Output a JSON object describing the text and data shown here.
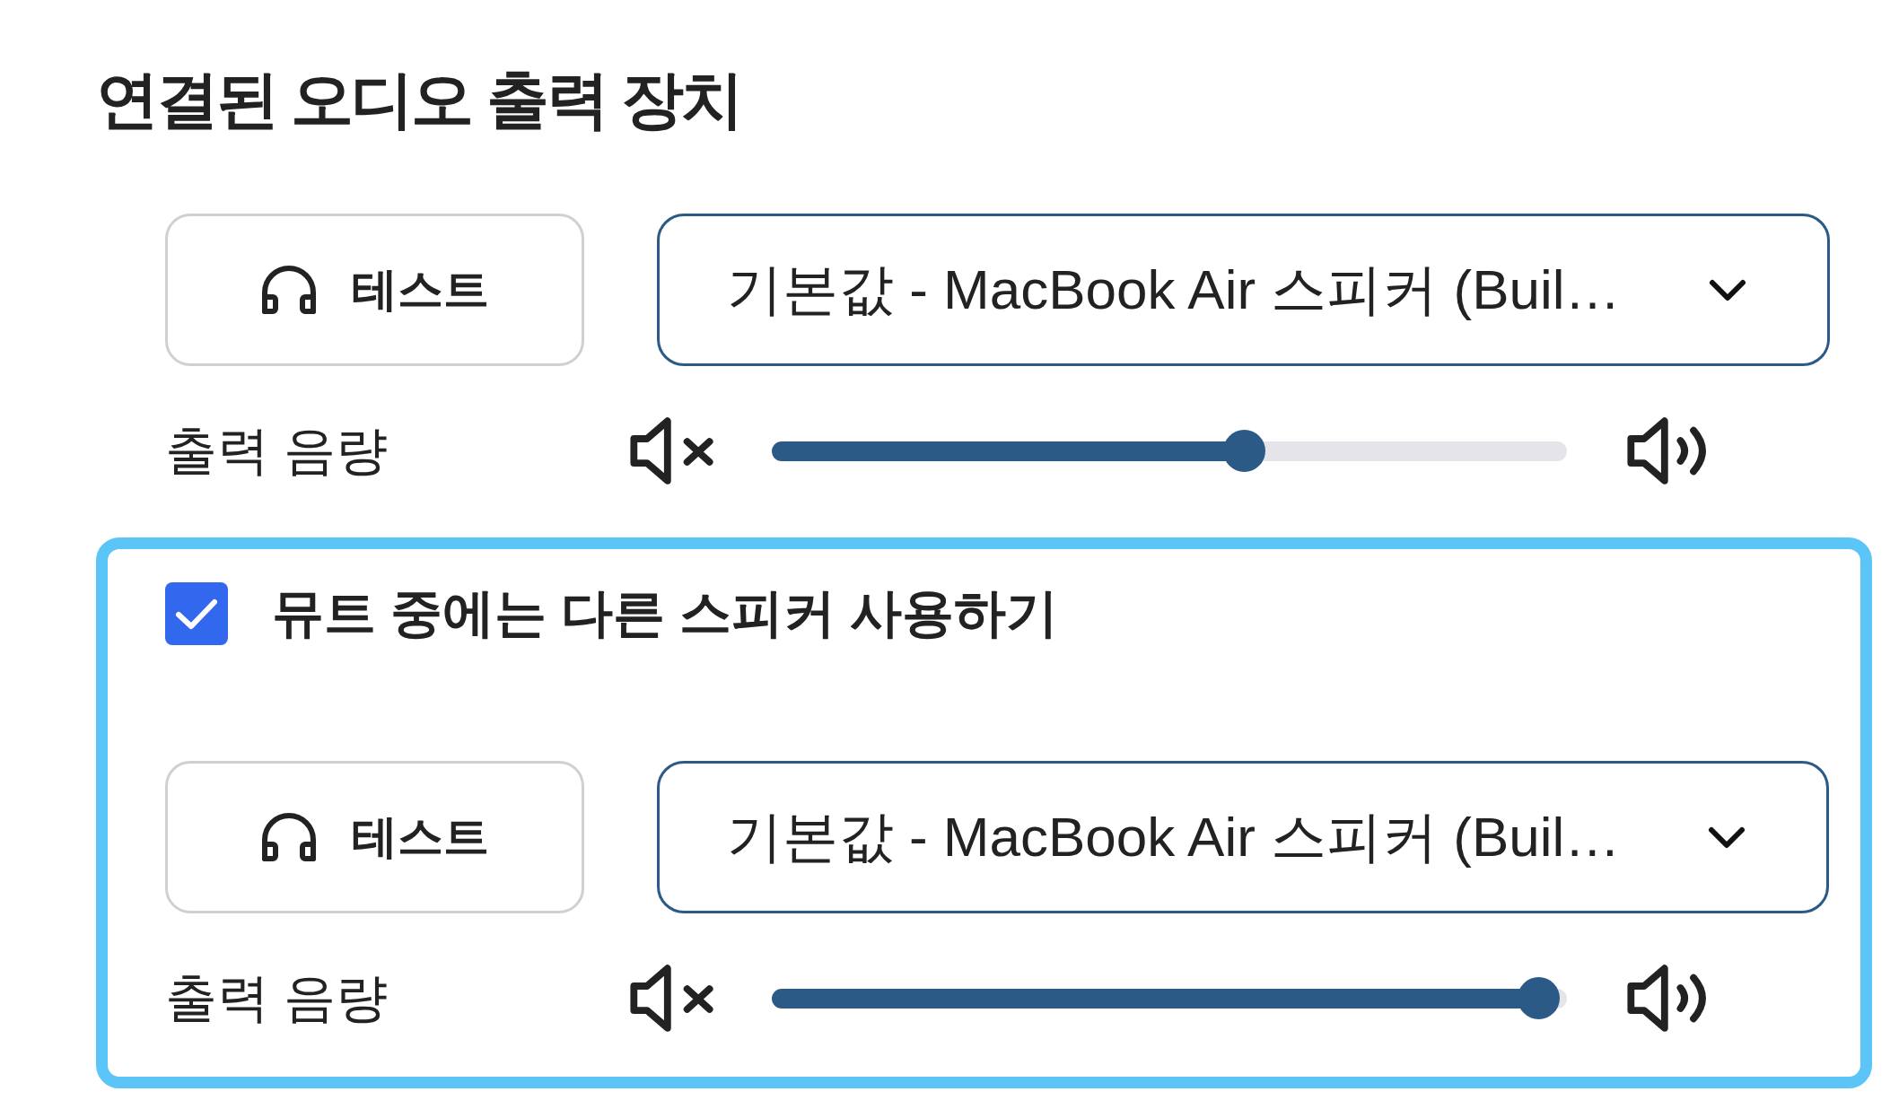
{
  "section_title": "연결된 오디오 출력 장치",
  "primary_output": {
    "test_button": {
      "label": "테스트"
    },
    "device_select": {
      "value": "기본값 - MacBook Air 스피커 (Buil…"
    },
    "volume": {
      "label": "출력 음량",
      "level": 0.6
    }
  },
  "mute_fallback": {
    "checkbox": {
      "label": "뮤트 중에는 다른 스피커 사용하기",
      "checked": true
    },
    "test_button": {
      "label": "테스트"
    },
    "device_select": {
      "value": "기본값 - MacBook Air 스피커 (Buil…"
    },
    "volume": {
      "label": "출력 음량",
      "level": 0.99
    }
  }
}
